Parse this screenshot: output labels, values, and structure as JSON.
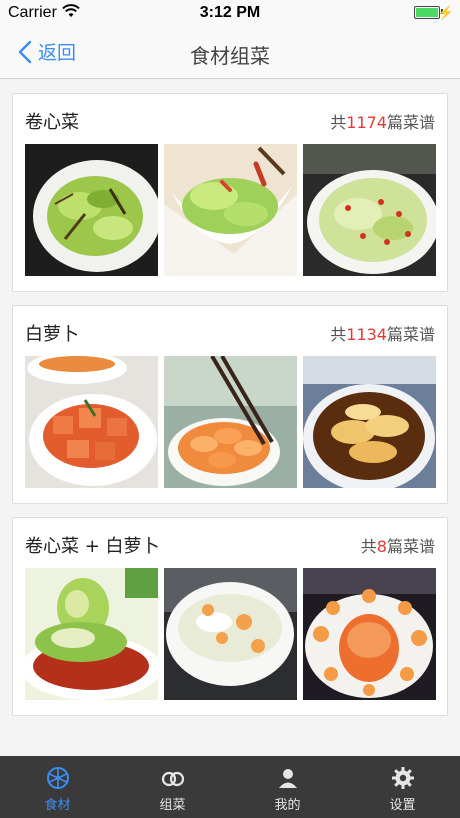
{
  "status_bar": {
    "carrier": "Carrier",
    "time": "3:12 PM"
  },
  "nav": {
    "back_label": "返回",
    "title": "食材组菜"
  },
  "cards": [
    {
      "name": "卷心菜",
      "count_prefix": "共",
      "count": "1174",
      "count_suffix": "篇菜谱"
    },
    {
      "name": "白萝卜",
      "count_prefix": "共",
      "count": "1134",
      "count_suffix": "篇菜谱"
    },
    {
      "name": "卷心菜 + 白萝卜",
      "count_prefix": "共",
      "count": "8",
      "count_suffix": "篇菜谱"
    }
  ],
  "tabbar": {
    "items": [
      {
        "label": "食材",
        "icon": "ingredients-icon"
      },
      {
        "label": "组菜",
        "icon": "combo-icon"
      },
      {
        "label": "我的",
        "icon": "user-icon"
      },
      {
        "label": "设置",
        "icon": "gear-icon"
      }
    ]
  },
  "colors": {
    "accent": "#3a8ff0",
    "count_highlight": "#e53935",
    "tabbar_bg": "#3a3a3a"
  }
}
